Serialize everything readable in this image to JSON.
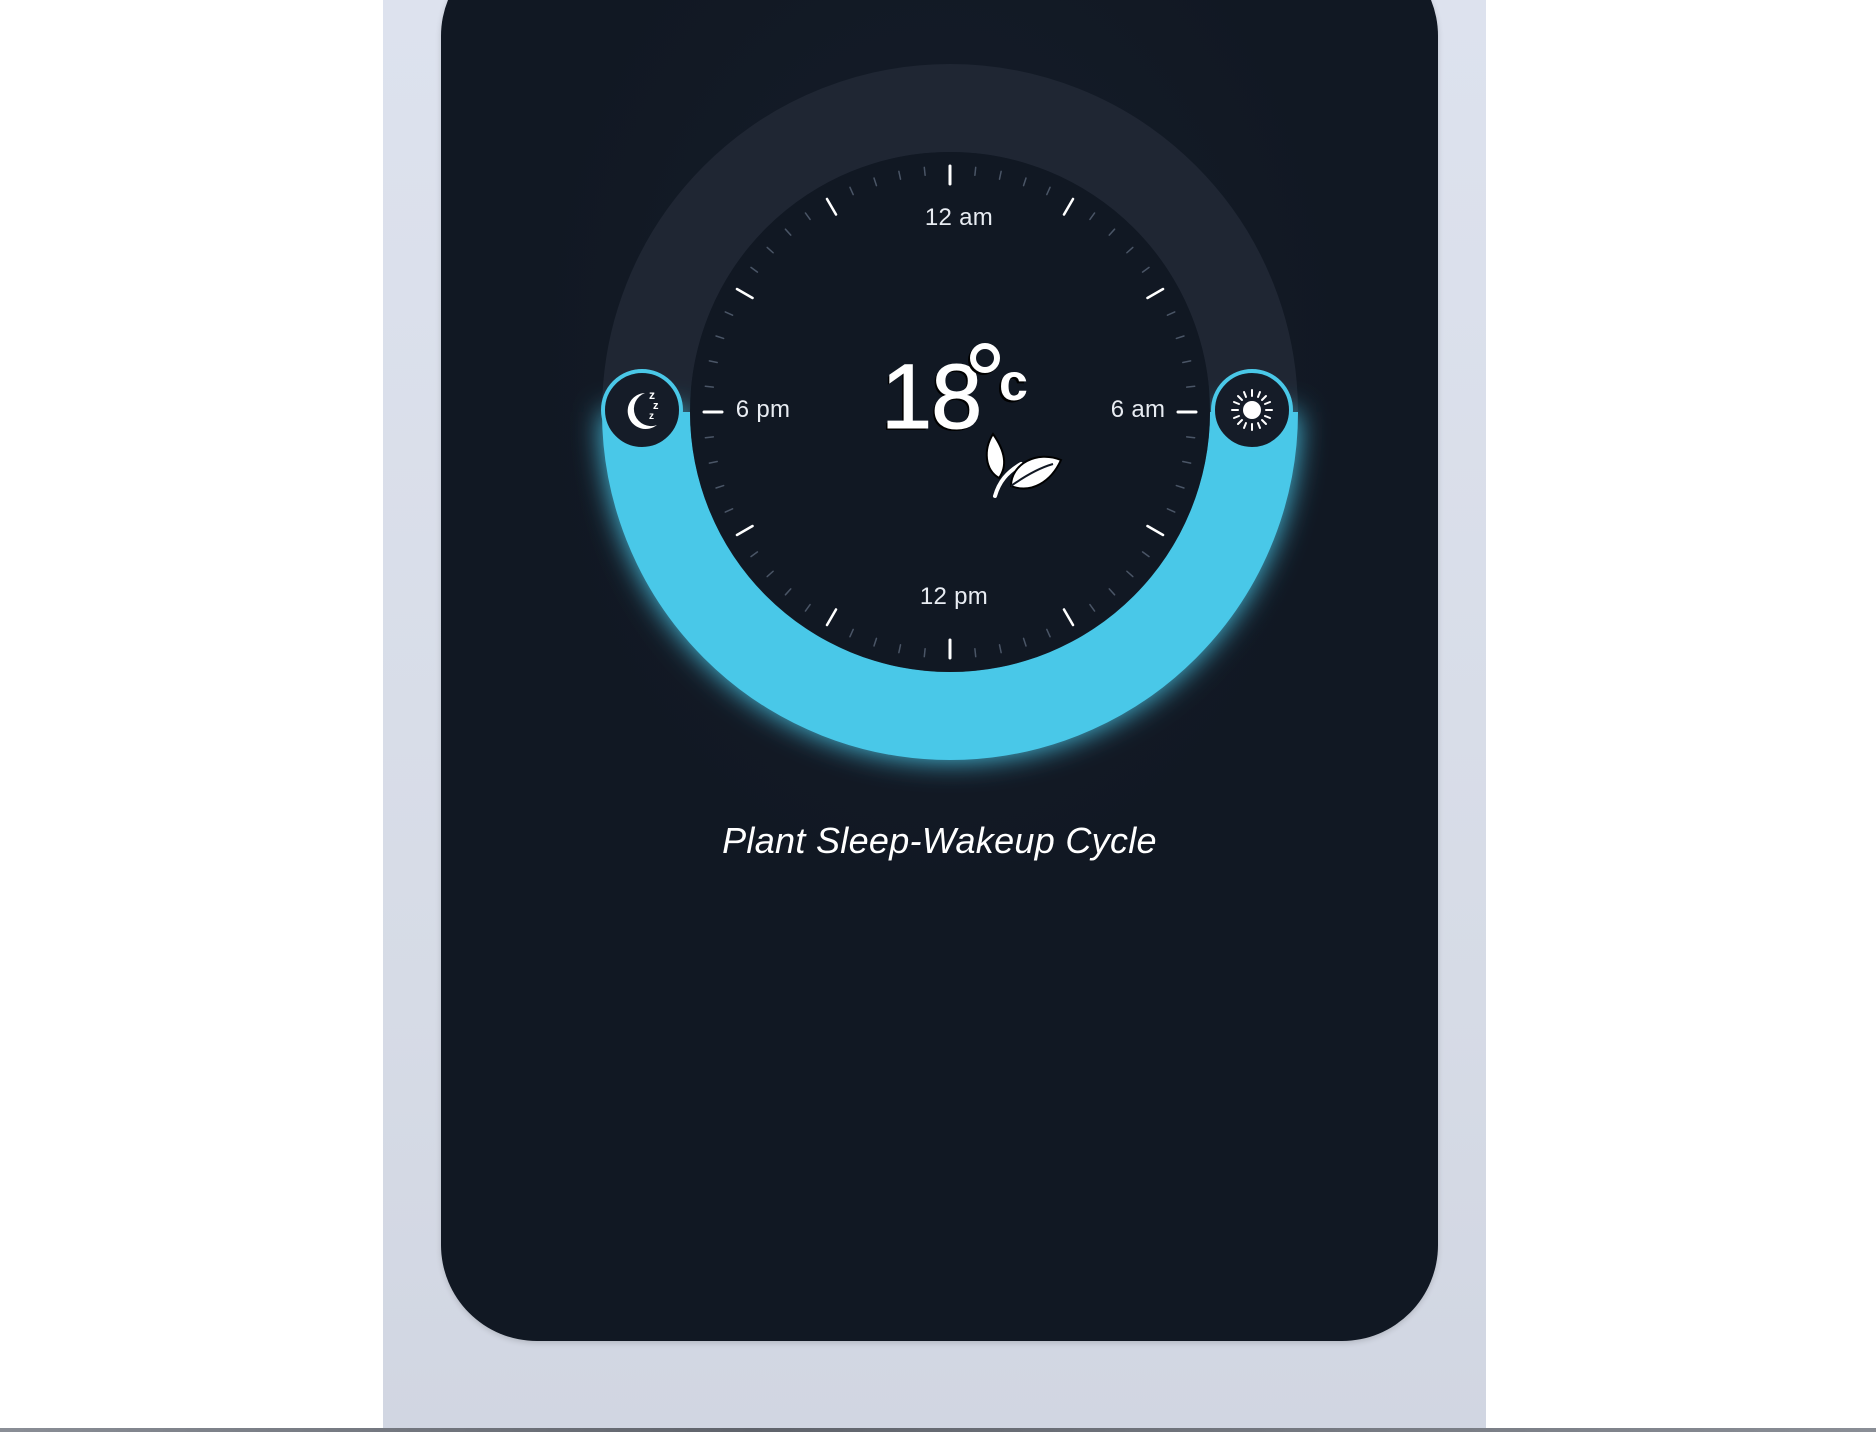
{
  "dial": {
    "temperature": "18",
    "unit": "c",
    "labels": {
      "top": "12 am",
      "left": "6 pm",
      "right": "6 am",
      "bottom": "12 pm"
    }
  },
  "caption": "Plant Sleep-Wakeup Cycle",
  "icons": {
    "sleep_knob": "moon-zzz-icon",
    "wake_knob": "sun-icon",
    "center": "leaf-icon",
    "degree": "degree-icon"
  },
  "colors": {
    "accent": "#4ac8e8",
    "phone_background": "#111823",
    "track": "#1f2633",
    "text": "#ffffff"
  }
}
